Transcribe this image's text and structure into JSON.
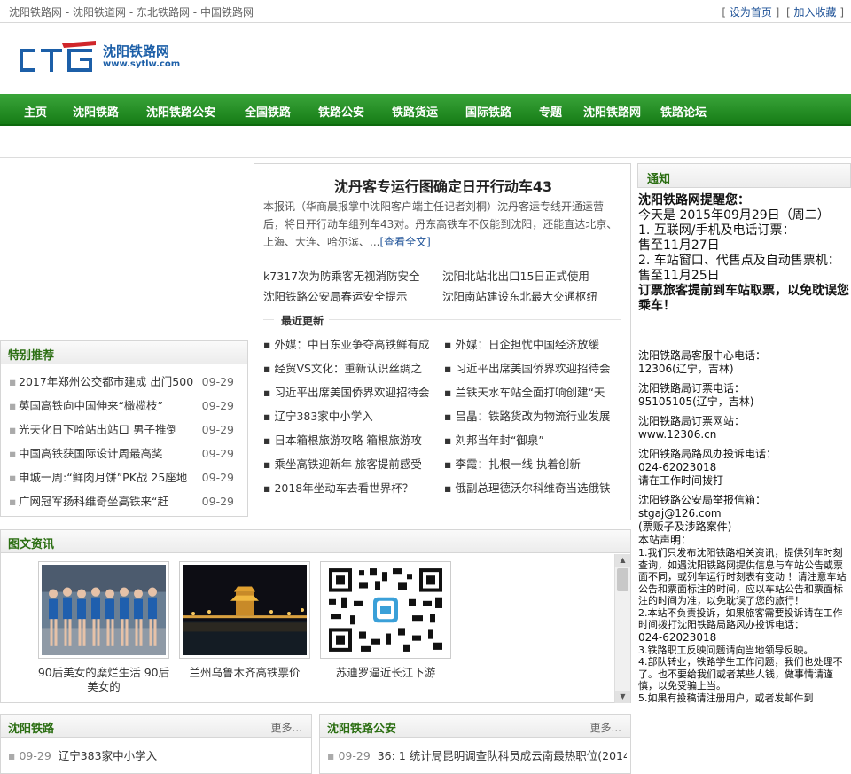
{
  "topbar": {
    "sites": [
      "沈阳铁路网",
      "沈阳铁道网",
      "东北铁路网",
      "中国铁路网"
    ],
    "separator": " - ",
    "set_home": "设为首页",
    "add_favorite": "加入收藏"
  },
  "logo": {
    "title": "沈阳铁路网",
    "url": "www.sytlw.com"
  },
  "nav": [
    "主页",
    "沈阳铁路",
    "沈阳铁路公安",
    "全国铁路",
    "铁路公安",
    "铁路货运",
    "国际铁路",
    "专题",
    "沈阳铁路网",
    "铁路论坛"
  ],
  "recommend": {
    "title": "特别推荐",
    "items": [
      {
        "text": "2017年郑州公交都市建成 出门500",
        "date": "09-29"
      },
      {
        "text": "英国高铁向中国伸来“橄榄枝”",
        "date": "09-29"
      },
      {
        "text": "光天化日下哈站出站口 男子推倒",
        "date": "09-29"
      },
      {
        "text": "中国高铁获国际设计周最高奖",
        "date": "09-29"
      },
      {
        "text": "申城一周:“鲜肉月饼”PK战 25座地",
        "date": "09-29"
      },
      {
        "text": "广网冠军扬科维奇坐高铁来“赶",
        "date": "09-29"
      }
    ]
  },
  "center": {
    "headline": "沈丹客专运行图确定日开行动车43",
    "summary": "本报讯（华商晨报掌中沈阳客户端主任记者刘桐）沈丹客运专线开通运营后，将日开行动车组列车43对。丹东高铁车不仅能到沈阳，还能直达北京、上海、大连、哈尔滨、...",
    "read_more": "[查看全文]",
    "headlines": [
      "k7317次为防乘客无视消防安全",
      "沈阳北站北出口15日正式使用",
      "沈阳铁路公安局春运安全提示",
      "沈阳南站建设东北最大交通枢纽"
    ],
    "latest_label": "最近更新",
    "latest": [
      "外媒：中日东亚争夺高铁鲜有成",
      "外媒：日企担忧中国经济放缓",
      "经贸VS文化：重新认识丝绸之",
      "习近平出席美国侨界欢迎招待会",
      "习近平出席美国侨界欢迎招待会",
      "兰铁天水车站全面打响创建“天",
      "辽宁383家中小学入",
      "吕晶：铁路货改为物流行业发展",
      "日本箱根旅游攻略 箱根旅游攻",
      "刘邦当年封“御泉”",
      "乘坐高铁迎新年 旅客提前感受",
      "李霞：扎根一线 执着创新",
      "2018年坐动车去看世界杯？",
      "俄副总理德沃尔科维奇当选俄铁"
    ]
  },
  "notice": {
    "title": "通知",
    "heading": "沈阳铁路网提醒您：",
    "today": "今天是 2015年09月29日（周二）",
    "lines": [
      "1. 互联网/手机及电话订票：",
      "售至11月27日",
      "2. 车站窗口、代售点及自动售票机：",
      "售至11月25日"
    ],
    "warning": "订票旅客提前到车站取票，以免耽误您乘车！",
    "contacts": [
      {
        "label": "沈阳铁路局客服中心电话：",
        "value": "12306(辽宁，吉林)"
      },
      {
        "label": "沈阳铁路局订票电话：",
        "value": "95105105(辽宁，吉林)"
      },
      {
        "label": "沈阳铁路局订票网站：",
        "value": "www.12306.cn"
      }
    ],
    "complaint_label": "沈阳铁路局路风办投诉电话：",
    "complaint_phone": "024-62023018",
    "complaint_note": "请在工作时间拨打",
    "police_label": "沈阳铁路公安局举报信箱：",
    "police_email": "stgaj@126.com",
    "police_note": "(票贩子及涉路案件)",
    "statement_label": "本站声明：",
    "statement_1": "1.我们只发布沈阳铁路相关资讯，提供列车时刻查询，如遇沈阳铁路网提供信息与车站公告或票面不同，或列车运行时刻表有变动 ！请注意车站公告和票面标注的时间，应以车站公告和票面标注的时间为准，以免耽误了您的旅行！",
    "statement_2": "2.本站不负责投诉，如果旅客需要投诉请在工作时间拨打沈阳铁路局路风办投诉电话：",
    "statement_2_phone": "024-62023018",
    "statement_3": "3.铁路职工反映问题请向当地领导反映。",
    "statement_4": "4.部队转业，铁路学生工作问题，我们也处理不了。也不要给我们或者某些人钱，做事情请谨慎，以免受骗上当。",
    "statement_5": "5.如果有投稿请注册用户，或者发邮件到"
  },
  "pics": {
    "title": "图文资讯",
    "items": [
      {
        "caption": "90后美女的糜烂生活 90后美女的"
      },
      {
        "caption": "兰州乌鲁木齐高铁票价"
      },
      {
        "caption": "苏迪罗逼近长江下游"
      }
    ]
  },
  "bottom": {
    "left": {
      "title": "沈阳铁路",
      "more": "更多...",
      "first": {
        "date": "09-29",
        "text": "辽宁383家中小学入"
      }
    },
    "right": {
      "title": "沈阳铁路公安",
      "more": "更多...",
      "first": {
        "date": "09-29",
        "text": "36: 1 统计局昆明调查队科员成云南最热职位(2014"
      }
    }
  },
  "colors": {
    "nav_green": "#1f8a1f",
    "head_green": "#2b6e12",
    "logo_blue": "#1c5fa8"
  }
}
